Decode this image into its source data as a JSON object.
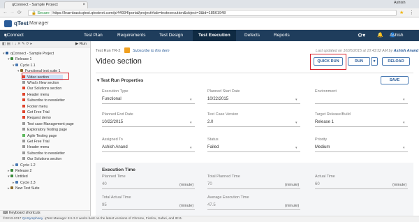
{
  "browser": {
    "tab_title": "qConnect - Sample Project",
    "secure_label": "Secure",
    "url": "https://learnbasicqtest.qtestnet.com/p/44934/portal/project#tab=testexecution&object=3&id=18561948",
    "user_name": "Ashish"
  },
  "app": {
    "logo": "qTest",
    "product": "Manager",
    "project": "qConnect - Sample Project",
    "user_full": "Ashish Anand"
  },
  "nav": {
    "tabs": [
      "Test Plan",
      "Requirements",
      "Test Design",
      "Test Execution",
      "Defects",
      "Reports"
    ],
    "active": "Test Execution"
  },
  "toolbar": {
    "run_label": "Run"
  },
  "tree": [
    {
      "label": "qConnect - Sample Project",
      "indent": 0,
      "type": "project"
    },
    {
      "label": "Release 1",
      "indent": 1,
      "type": "release"
    },
    {
      "label": "Cycle 1.1",
      "indent": 2,
      "type": "cycle"
    },
    {
      "label": "Functional test suite 1",
      "indent": 3,
      "type": "suite"
    },
    {
      "label": "Video section",
      "indent": 4,
      "type": "run",
      "color": "#e0452d",
      "selected": true
    },
    {
      "label": "What's New section",
      "indent": 4,
      "type": "run",
      "color": "#999999"
    },
    {
      "label": "Our Solutions section",
      "indent": 4,
      "type": "run",
      "color": "#e0452d"
    },
    {
      "label": "Header menu",
      "indent": 4,
      "type": "run",
      "color": "#e0452d"
    },
    {
      "label": "Subscribe to newsletter",
      "indent": 4,
      "type": "run",
      "color": "#e0452d"
    },
    {
      "label": "Footer menu",
      "indent": 4,
      "type": "run",
      "color": "#e0452d"
    },
    {
      "label": "Get Free Trial",
      "indent": 4,
      "type": "run",
      "color": "#e0452d"
    },
    {
      "label": "Request demo",
      "indent": 4,
      "type": "run",
      "color": "#e0452d"
    },
    {
      "label": "Test case Management page",
      "indent": 4,
      "type": "run",
      "color": "#999999"
    },
    {
      "label": "Exploratory Testing page",
      "indent": 4,
      "type": "run",
      "color": "#999999"
    },
    {
      "label": "Agile Testing page",
      "indent": 4,
      "type": "run",
      "color": "#5cb85c"
    },
    {
      "label": "Get Free Trial",
      "indent": 4,
      "type": "run",
      "color": "#999999"
    },
    {
      "label": "Header menu",
      "indent": 4,
      "type": "run",
      "color": "#999999"
    },
    {
      "label": "Subscribe to newsletter",
      "indent": 4,
      "type": "run",
      "color": "#999999"
    },
    {
      "label": "Our Solutions section",
      "indent": 4,
      "type": "run",
      "color": "#999999"
    },
    {
      "label": "Cycle 1.2",
      "indent": 2,
      "type": "cycle"
    },
    {
      "label": "Release 2",
      "indent": 1,
      "type": "release"
    },
    {
      "label": "Untitled",
      "indent": 1,
      "type": "release"
    },
    {
      "label": "Cycle 2.3",
      "indent": 2,
      "type": "cycle"
    },
    {
      "label": "New Test Suite",
      "indent": 1,
      "type": "suite"
    }
  ],
  "keyboard_shortcuts": "Keyboard shortcuts",
  "testrun": {
    "label": "Test Run",
    "id": "TR-2",
    "subscribe": "Subscribe to this item",
    "last_updated": "Last updated on 10/26/2015 at 10:43:52 AM by",
    "updated_by": "Ashish Anand",
    "title": "Video section",
    "buttons": {
      "quick_run": "QUICK RUN",
      "run": "RUN",
      "reload": "RELOAD",
      "save": "SAVE"
    }
  },
  "properties": {
    "section_title": "Test Run Properties",
    "fields": [
      {
        "label": "Execution Type",
        "value": "Functional",
        "dropdown": true
      },
      {
        "label": "Planned Start Date",
        "value": "10/22/2015",
        "dropdown": true
      },
      {
        "label": "Environment",
        "value": "",
        "dropdown": true
      },
      {
        "label": "Planned End Date",
        "value": "10/22/2015",
        "dropdown": true
      },
      {
        "label": "Test Case Version",
        "value": "2.0",
        "dropdown": true
      },
      {
        "label": "Target Release/Build",
        "value": "Release 1",
        "dropdown": true
      },
      {
        "label": "Assigned To",
        "value": "Ashish Anand",
        "dropdown": true
      },
      {
        "label": "Status",
        "value": "Failed",
        "dropdown": true
      },
      {
        "label": "Priority",
        "value": "Medium",
        "dropdown": true
      }
    ]
  },
  "execution_time": {
    "section_title": "Execution Time",
    "unit": "(minute)",
    "fields": [
      {
        "label": "Planned Time",
        "value": "40"
      },
      {
        "label": "Total Planned Time",
        "value": "70"
      },
      {
        "label": "Actual Time",
        "value": "60"
      },
      {
        "label": "Total Actual Time",
        "value": "95"
      },
      {
        "label": "Average Execution Time",
        "value": "47.5"
      }
    ]
  },
  "footer": {
    "copyright": "©2013-2017",
    "company": "QASymphony",
    "notice": "qTest Manager 8.5.3.2 works best on the latest versions of Chrome, Firefox, Safari, and IE11."
  },
  "colors": {
    "nav_bg": "#1f3d5c",
    "nav_active": "#0f2a42",
    "accent": "#2a5c99",
    "highlight": "#d9232e"
  }
}
